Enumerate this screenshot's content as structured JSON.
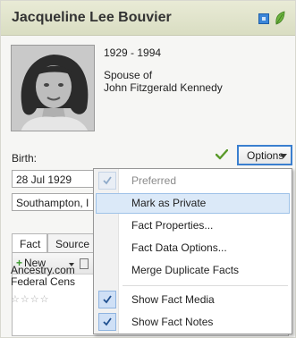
{
  "person": {
    "name": "Jacqueline Lee Bouvier",
    "dates": "1929 - 1994",
    "relation_line1": "Spouse of",
    "relation_line2": "John Fitzgerald Kennedy"
  },
  "fact": {
    "label": "Birth:",
    "date_value": "28 Jul 1929",
    "place_value": "Southampton, I"
  },
  "options_button": {
    "label": "Options"
  },
  "tabs": [
    {
      "label": "Fact"
    },
    {
      "label": "Source"
    }
  ],
  "toolbar": {
    "new_label": "New"
  },
  "source_item": {
    "line1": "Ancestry.com",
    "line2": "Federal Cens",
    "stars": "☆☆☆☆"
  },
  "menu": {
    "items": [
      {
        "label": "Preferred",
        "checked": true,
        "disabled": true
      },
      {
        "label": "Mark as Private",
        "checked": false,
        "highlighted": true
      },
      {
        "label": "Fact Properties...",
        "checked": false
      },
      {
        "label": "Fact Data Options...",
        "checked": false
      },
      {
        "label": "Merge Duplicate Facts",
        "checked": false
      },
      {
        "label": "Show Fact Media",
        "checked": true
      },
      {
        "label": "Show Fact Notes",
        "checked": true
      }
    ]
  },
  "colors": {
    "header_bg": "#dfe2c9",
    "accent_blue": "#3a7fcf",
    "check_green": "#5a9a2a",
    "menu_highlight": "#dbe9f8"
  },
  "icons": {
    "header_icon_1": "blue-square-icon",
    "header_icon_2": "green-leaf-icon",
    "verified": "green-check-icon",
    "new": "green-plus-icon"
  }
}
